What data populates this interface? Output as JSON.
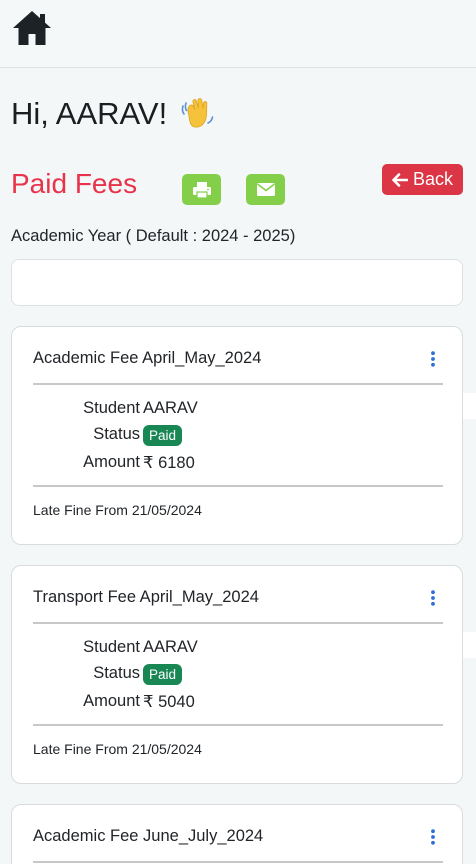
{
  "nav": {
    "home_icon": "home-icon"
  },
  "greeting": {
    "text": "Hi, AARAV!",
    "emoji": "waving-hand-icon"
  },
  "section": {
    "title": "Paid Fees",
    "back_label": "Back"
  },
  "actions": {
    "print_icon": "print-icon",
    "mail_icon": "envelope-icon"
  },
  "academic_year": {
    "label": "Academic Year ( Default : 2024 - 2025)",
    "value": ""
  },
  "fees": [
    {
      "title": "Academic Fee April_May_2024",
      "student_label": "Student",
      "student": "AARAV",
      "status_label": "Status",
      "status": "Paid",
      "amount_label": "Amount",
      "amount": "₹ 6180",
      "late_fine": "Late Fine From 21/05/2024"
    },
    {
      "title": "Transport Fee April_May_2024",
      "student_label": "Student",
      "student": "AARAV",
      "status_label": "Status",
      "status": "Paid",
      "amount_label": "Amount",
      "amount": "₹ 5040",
      "late_fine": "Late Fine From 21/05/2024"
    },
    {
      "title": "Academic Fee June_July_2024"
    }
  ],
  "colors": {
    "accent_red": "#e8334a",
    "back_red": "#dc3545",
    "green_btn": "#84cf4a",
    "paid_green": "#198754",
    "kebab_blue": "#2f6fd6"
  }
}
